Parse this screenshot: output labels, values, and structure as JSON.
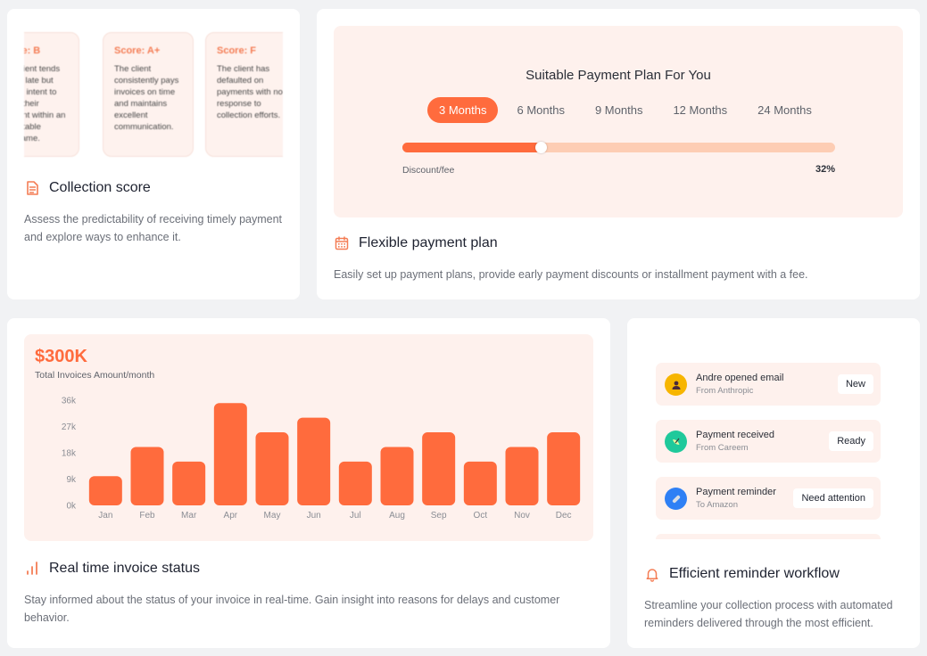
{
  "colors": {
    "accent": "#ff6b3d",
    "accent_light": "#fdcdb4",
    "panel_bg": "#fef1ed",
    "page_bg": "#f1f2f4"
  },
  "collection_score": {
    "score_cards": [
      {
        "label": "Score: B",
        "text": "The client tends to pay late but shows intent to settle their account within an acceptable timeframe."
      },
      {
        "label": "Score: A+",
        "text": "The client consistently pays invoices on time and maintains excellent communication."
      },
      {
        "label": "Score: F",
        "text": "The client has defaulted on payments with no response to collection efforts."
      }
    ],
    "icon": "document-icon",
    "title": "Collection score",
    "description": "Assess the predictability of receiving timely payment and explore ways to enhance it."
  },
  "payment_plan": {
    "heading": "Suitable Payment Plan For You",
    "tabs": [
      {
        "label": "3 Months",
        "active": true
      },
      {
        "label": "6 Months",
        "active": false
      },
      {
        "label": "9 Months",
        "active": false
      },
      {
        "label": "12 Months",
        "active": false
      },
      {
        "label": "24 Months",
        "active": false
      }
    ],
    "slider_label": "Discount/fee",
    "slider_value_text": "32%",
    "slider_fraction": 0.32,
    "icon": "calendar-icon",
    "title": "Flexible payment plan",
    "description": "Easily set up payment plans, provide early payment discounts or installment payment with a fee."
  },
  "invoice_status": {
    "amount": "$300K",
    "amount_caption": "Total Invoices Amount/month",
    "icon": "signal-bars-icon",
    "title": "Real time invoice status",
    "description": "Stay informed about the status of your invoice in real-time. Gain insight into reasons for delays and customer behavior."
  },
  "chart_data": {
    "type": "bar",
    "title": "$300K",
    "subtitle": "Total Invoices Amount/month",
    "xlabel": "",
    "ylabel": "",
    "categories": [
      "Jan",
      "Feb",
      "Mar",
      "Apr",
      "May",
      "Jun",
      "Jul",
      "Aug",
      "Sep",
      "Oct",
      "Nov",
      "Dec"
    ],
    "values": [
      10000,
      20000,
      15000,
      35000,
      25000,
      30000,
      15000,
      20000,
      25000,
      15000,
      20000,
      25000
    ],
    "ylim": [
      0,
      36000
    ],
    "yticks": [
      0,
      9000,
      18000,
      27000,
      36000
    ],
    "ytick_labels": [
      "0k",
      "9k",
      "18k",
      "27k",
      "36k"
    ],
    "grid": false,
    "legend": "none",
    "bar_color": "#ff6b3d"
  },
  "reminders": {
    "items": [
      {
        "title": "Andre opened email",
        "subtitle": "From Anthropic",
        "badge": "New",
        "icon": "user-icon",
        "avatar_color": "#f7b500"
      },
      {
        "title": "Payment received",
        "subtitle": "From Careem",
        "badge": "Ready",
        "icon": "leaf-icon",
        "avatar_color": "#1fc99b"
      },
      {
        "title": "Payment reminder",
        "subtitle": "To Amazon",
        "badge": "Need attention",
        "icon": "bandage-icon",
        "avatar_color": "#2f80f5"
      }
    ],
    "icon": "bell-icon",
    "title": "Efficient reminder workflow",
    "description": "Streamline your collection process with automated reminders delivered through the most efficient."
  }
}
